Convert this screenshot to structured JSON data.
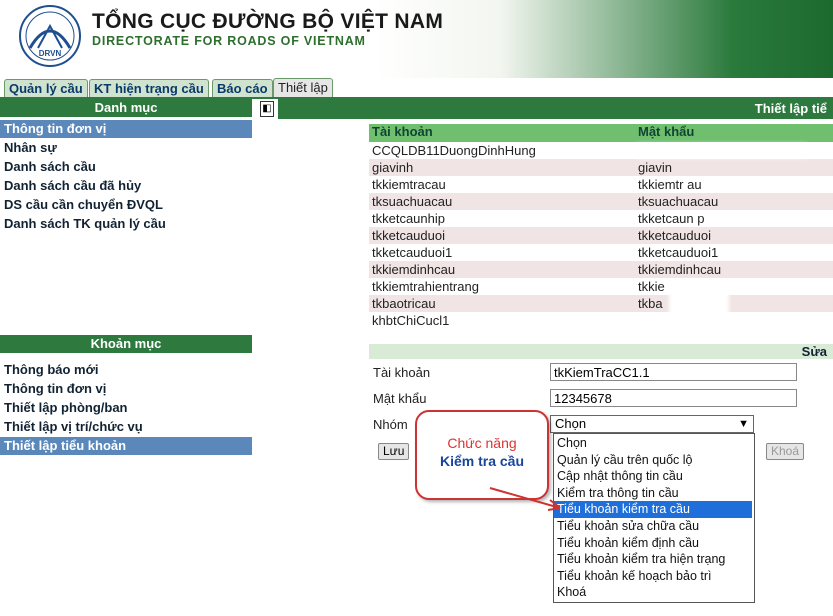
{
  "header": {
    "title": "TỔNG CỤC ĐƯỜNG BỘ VIỆT NAM",
    "subtitle": "DIRECTORATE FOR ROADS OF VIETNAM",
    "logo_text": "DRVN"
  },
  "tabs": [
    {
      "label": "Quản lý cầu",
      "active": false
    },
    {
      "label": "KT hiện trạng cầu",
      "active": false
    },
    {
      "label": "Báo cáo",
      "active": false
    },
    {
      "label": "Thiết lập",
      "active": true
    }
  ],
  "sidebar": {
    "section1_title": "Danh mục",
    "section1_items": [
      {
        "label": "Thông tin đơn vị",
        "selected": true
      },
      {
        "label": "Nhân sự",
        "selected": false
      },
      {
        "label": "Danh sách cầu",
        "selected": false
      },
      {
        "label": "Danh sách cầu đã hủy",
        "selected": false
      },
      {
        "label": "DS cầu cần chuyển ĐVQL",
        "selected": false
      },
      {
        "label": "Danh sách TK quản lý cầu",
        "selected": false
      }
    ],
    "section2_title": "Khoản mục",
    "section2_items": [
      {
        "label": "Thông báo mới",
        "selected": false
      },
      {
        "label": "Thông tin đơn vị",
        "selected": false
      },
      {
        "label": "Thiết lập phòng/ban",
        "selected": false
      },
      {
        "label": "Thiết lập vị trí/chức vụ",
        "selected": false
      },
      {
        "label": "Thiết lập tiểu khoản",
        "selected": true
      }
    ]
  },
  "main": {
    "bar_title": "Thiết lập tiể",
    "table": {
      "headers": [
        "Tài khoản",
        "Mật khẩu"
      ],
      "rows": [
        {
          "account": "CCQLDB11DuongDinhHung",
          "password": ""
        },
        {
          "account": "giavinh",
          "password": "giavin"
        },
        {
          "account": "tkkiemtracau",
          "password": "tkkiemtr  au"
        },
        {
          "account": "tksuachuacau",
          "password": "tksuachuacau"
        },
        {
          "account": "tkketcaunhip",
          "password": "tkketcaun  p"
        },
        {
          "account": "tkketcauduoi",
          "password": "tkketcauduoi"
        },
        {
          "account": "tkketcauduoi1",
          "password": "tkketcauduoi1"
        },
        {
          "account": "tkkiemdinhcau",
          "password": "tkkiemdinhcau"
        },
        {
          "account": "tkkiemtrahientrang",
          "password": "tkkie"
        },
        {
          "account": "tkbaotricau",
          "password": "tkba"
        },
        {
          "account": "khbtChiCucl1",
          "password": ""
        }
      ]
    },
    "form": {
      "header": "Sửa",
      "account_label": "Tài khoản",
      "account_value": "tkKiemTraCC1.1",
      "password_label": "Mật khẩu",
      "password_value": "12345678",
      "group_label": "Nhóm",
      "group_selected": "Chọn",
      "save_button": "Lưu",
      "lock_button": "Khoá"
    },
    "dropdown_options": [
      {
        "label": "Chọn",
        "highlighted": false
      },
      {
        "label": "Quản lý cầu trên quốc lộ",
        "highlighted": false
      },
      {
        "label": "Cập nhật thông tin cầu",
        "highlighted": false
      },
      {
        "label": "Kiểm tra thông tin cầu",
        "highlighted": false
      },
      {
        "label": "Tiểu khoản kiểm tra cầu",
        "highlighted": true
      },
      {
        "label": "Tiểu khoản sửa chữa cầu",
        "highlighted": false
      },
      {
        "label": "Tiểu khoản kiểm định cầu",
        "highlighted": false
      },
      {
        "label": "Tiểu khoản kiểm tra hiện trạng",
        "highlighted": false
      },
      {
        "label": "Tiểu khoản kế hoạch bảo trì",
        "highlighted": false
      },
      {
        "label": "Khoá",
        "highlighted": false
      }
    ],
    "callout": {
      "line1": "Chức năng",
      "line2": "Kiểm tra cầu"
    }
  },
  "colors": {
    "brand_green": "#2e7a3e",
    "table_header": "#6fbf6f",
    "selection_blue": "#5b88bb",
    "highlight_blue": "#1e6fd9",
    "callout_border": "#cc3333"
  }
}
